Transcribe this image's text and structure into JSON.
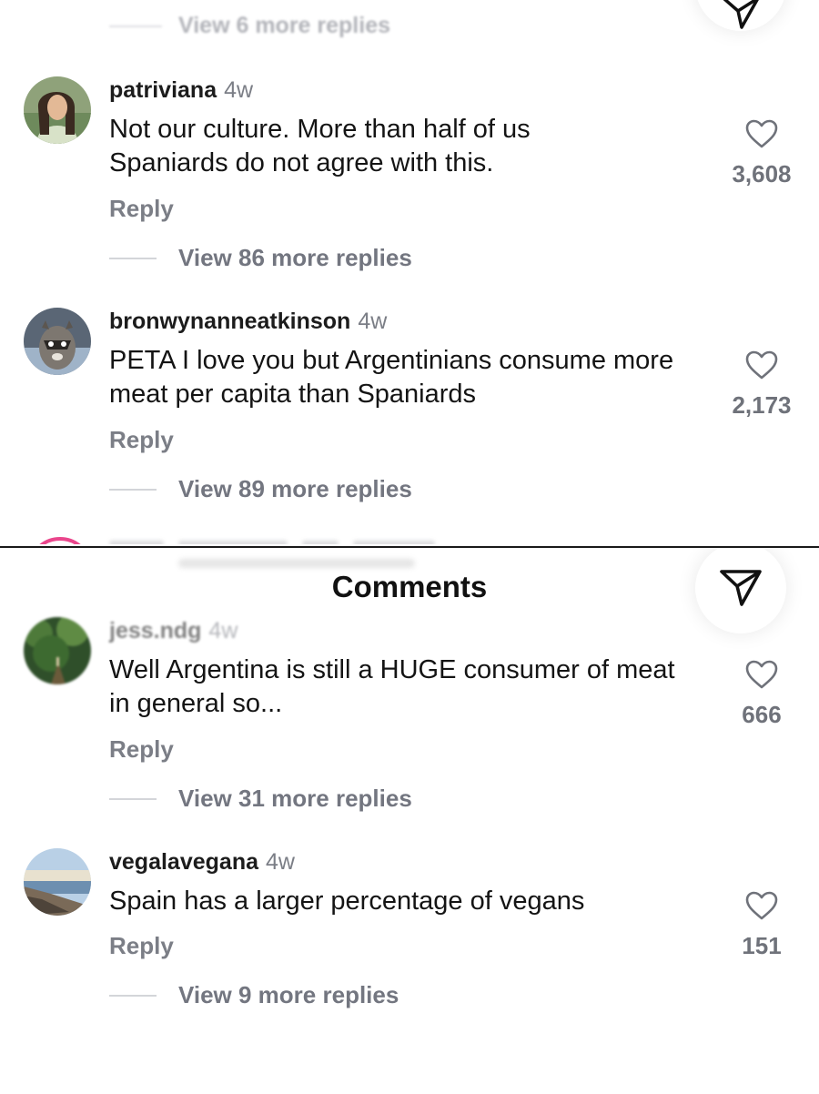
{
  "top_panel": {
    "faded_replies": "View 6 more replies",
    "comments": [
      {
        "username": "patriviana",
        "time": "4w",
        "text": "Not our culture. More than half of us Spaniards do not agree with this.",
        "reply": "Reply",
        "view_replies": "View 86 more replies",
        "likes": "3,608"
      },
      {
        "username": "bronwynanneatkinson",
        "time": "4w",
        "text": "PETA I love you but Argentinians consume more meat per capita than Spaniards",
        "reply": "Reply",
        "view_replies": "View 89 more replies",
        "likes": "2,173"
      }
    ]
  },
  "bottom_panel": {
    "title": "Comments",
    "comments": [
      {
        "username": "jess.ndg",
        "time": "4w",
        "text": "Well Argentina is still a HUGE consumer of meat in general so...",
        "reply": "Reply",
        "view_replies": "View 31 more replies",
        "likes": "666"
      },
      {
        "username": "vegalavegana",
        "time": "4w",
        "text": "Spain has a larger percentage of vegans",
        "reply": "Reply",
        "view_replies": "View 9 more replies",
        "likes": "151"
      }
    ]
  },
  "icons": {
    "like": "heart-outline-icon",
    "share": "paper-plane-icon"
  },
  "colors": {
    "username": "#1c1c1c",
    "muted": "#7b7e86",
    "story_ring": "#e8327f"
  }
}
